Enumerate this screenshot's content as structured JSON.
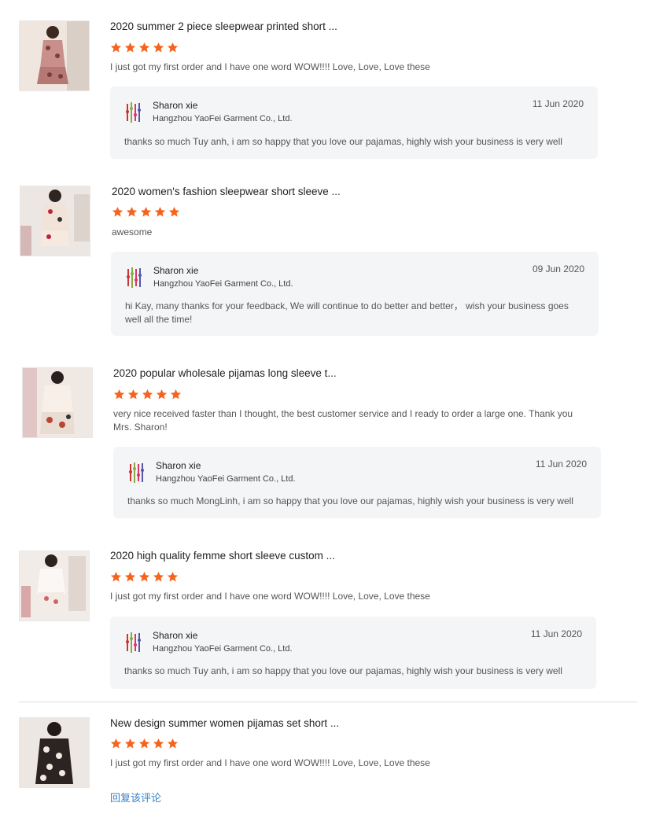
{
  "colors": {
    "star": "#f5641e",
    "link": "#3b82c4",
    "reply_bg": "#f4f5f7"
  },
  "reviews": [
    {
      "title": "2020 summer 2 piece sleepwear printed short ...",
      "rating": 5,
      "comment": "I just got my first order and I have one word WOW!!!! Love, Love, Love these",
      "reply": {
        "seller": "Sharon xie",
        "company": "Hangzhou YaoFei Garment Co., Ltd.",
        "date": "11 Jun 2020",
        "text": "thanks so much Tuy anh, i am so happy that you love our pajamas, highly wish your business is very well"
      }
    },
    {
      "title": "2020 women's fashion sleepwear short sleeve ...",
      "rating": 5,
      "comment": "awesome",
      "reply": {
        "seller": "Sharon xie",
        "company": "Hangzhou YaoFei Garment Co., Ltd.",
        "date": "09 Jun 2020",
        "text": "hi Kay, many thanks for your feedback, We will continue to do better and better， wish your business goes well all the time!"
      }
    },
    {
      "title": "2020 popular wholesale pijamas long sleeve t...",
      "rating": 5,
      "comment": "very nice received faster than I thought, the best customer service and I ready to order a large one. Thank you Mrs. Sharon!",
      "reply": {
        "seller": "Sharon xie",
        "company": "Hangzhou YaoFei Garment Co., Ltd.",
        "date": "11 Jun 2020",
        "text": "thanks so much MongLinh, i am so happy that you love our pajamas, highly wish your business is very well"
      }
    },
    {
      "title": "2020 high quality femme short sleeve custom ...",
      "rating": 5,
      "comment": "I just got my first order and I have one word WOW!!!! Love, Love, Love these",
      "reply": {
        "seller": "Sharon xie",
        "company": "Hangzhou YaoFei Garment Co., Ltd.",
        "date": "11 Jun 2020",
        "text": "thanks so much Tuy anh, i am so happy that you love our pajamas, highly wish your business is very well"
      }
    },
    {
      "title": "New design summer women pijamas set short ...",
      "rating": 5,
      "comment": "I just got my first order and I have one word WOW!!!! Love, Love, Love these",
      "reply_link": "回复该评论"
    }
  ]
}
